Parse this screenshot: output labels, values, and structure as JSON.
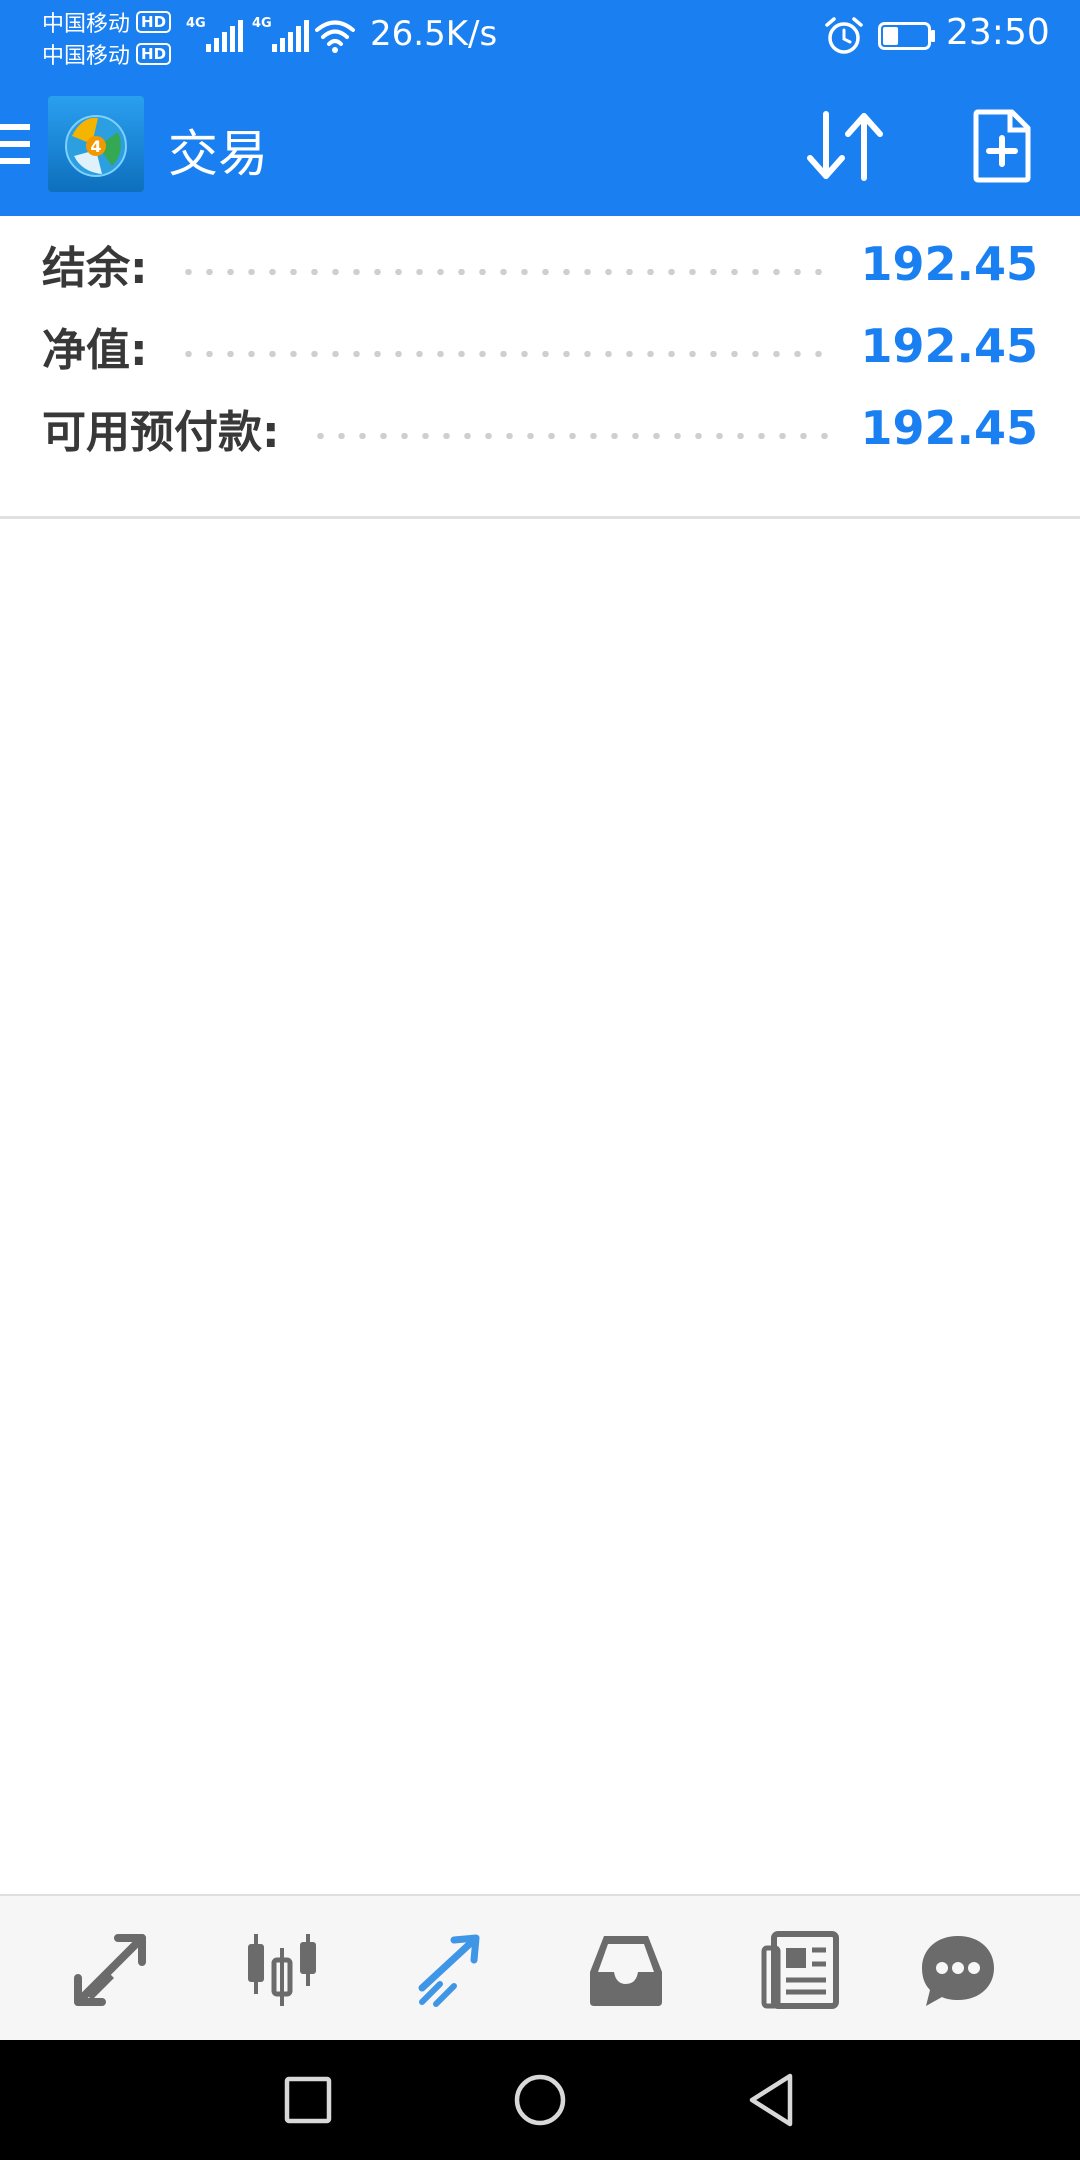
{
  "status_bar": {
    "carrier_1": "中国移动",
    "carrier_2": "中国移动",
    "hd_badge": "HD",
    "network_1": "4G",
    "network_2": "4G",
    "net_speed": "26.5K/s",
    "time": "23:50",
    "battery_level_fraction": 0.35
  },
  "app_bar": {
    "title": "交易",
    "logo_badge": "4",
    "icons": [
      "menu-icon",
      "app-logo",
      "sort-icon",
      "new-order-icon"
    ]
  },
  "account": {
    "rows": [
      {
        "label": "结余:",
        "value": "192.45"
      },
      {
        "label": "净值:",
        "value": "192.45"
      },
      {
        "label": "可用预付款:",
        "value": "192.45"
      }
    ]
  },
  "bottom_nav": {
    "items": [
      "quotes-icon",
      "chart-icon",
      "trade-icon",
      "history-icon",
      "news-icon",
      "chat-icon"
    ],
    "active": "trade-icon"
  },
  "colors": {
    "primary": "#1a7ff0",
    "label_text": "#383838",
    "value_text": "#1a7ff0",
    "nav_icon": "#6b6b6b",
    "nav_active": "#3f95e6"
  }
}
